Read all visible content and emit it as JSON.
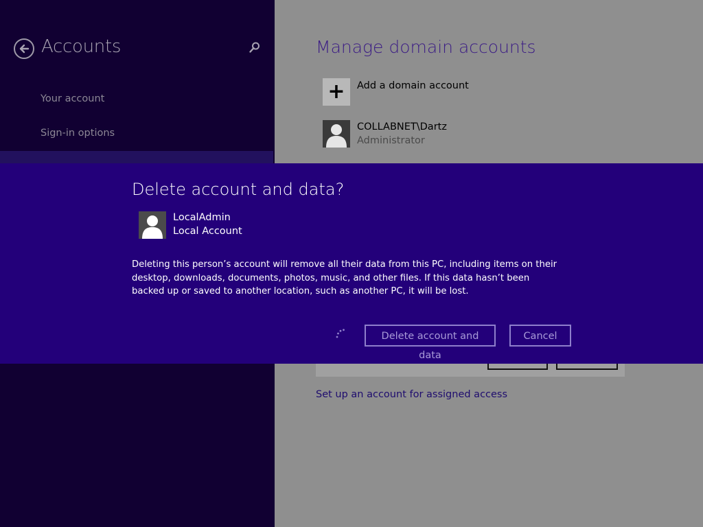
{
  "left": {
    "title": "Accounts",
    "nav_items": [
      "Your account",
      "Sign-in options"
    ]
  },
  "main": {
    "title": "Manage domain accounts",
    "add_label": "Add a domain account",
    "add_glyph": "+",
    "user": {
      "name": "COLLABNET\\Dartz",
      "role": "Administrator"
    },
    "assigned_access_link": "Set up an account for assigned access"
  },
  "dialog": {
    "title": "Delete account and data?",
    "account_name": "LocalAdmin",
    "account_type": "Local Account",
    "message": "Deleting this person’s account will remove all their data from this PC, including items on their desktop, downloads, documents, photos, music, and other files. If this data hasn’t been backed up or saved to another location, such as another PC, it will be lost.",
    "delete_label": "Delete account and data",
    "cancel_label": "Cancel"
  },
  "icons": [
    "back-arrow-icon",
    "search-icon",
    "add-icon",
    "user-avatar-icon",
    "loading-spinner-icon"
  ],
  "colors": {
    "left_pane": "#110032",
    "dialog": "#23007a",
    "title_accent": "#3c1d85",
    "button_border": "#8f7fcc"
  }
}
